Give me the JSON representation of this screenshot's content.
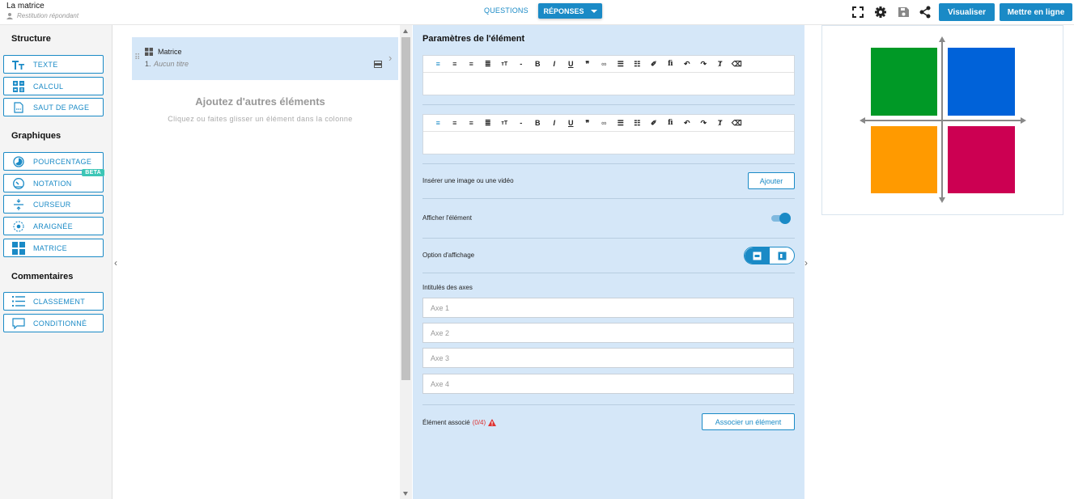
{
  "header": {
    "title": "La matrice",
    "subtitle": "Restitution répondant",
    "tabs": [
      {
        "label": "QUESTIONS"
      },
      {
        "label": "RÉPONSES"
      }
    ],
    "icons": [
      "fullscreen-icon",
      "gear-icon",
      "save-icon",
      "share-icon"
    ],
    "preview_label": "Visualiser",
    "publish_label": "Mettre en ligne"
  },
  "palette": {
    "sections": [
      {
        "title": "Structure",
        "items": [
          {
            "label": "TEXTE",
            "icon": "text-size-icon"
          },
          {
            "label": "CALCUL",
            "icon": "calculator-icon"
          },
          {
            "label": "SAUT DE PAGE",
            "icon": "page-break-icon"
          }
        ]
      },
      {
        "title": "Graphiques",
        "items": [
          {
            "label": "POURCENTAGE",
            "icon": "percentage-icon"
          },
          {
            "label": "NOTATION",
            "icon": "gauge-icon",
            "badge": "BETA"
          },
          {
            "label": "CURSEUR",
            "icon": "slider-icon"
          },
          {
            "label": "ARAIGNÉE",
            "icon": "spider-icon"
          },
          {
            "label": "MATRICE",
            "icon": "matrix-icon"
          }
        ]
      },
      {
        "title": "Commentaires",
        "items": [
          {
            "label": "CLASSEMENT",
            "icon": "list-icon"
          },
          {
            "label": "CONDITIONNÉ",
            "icon": "comment-icon"
          }
        ]
      }
    ]
  },
  "column": {
    "item": {
      "type": "Matrice",
      "number": "1.",
      "title": "Aucun titre"
    },
    "empty_title": "Ajoutez d'autres éléments",
    "empty_hint": "Cliquez ou faites glisser un élément dans la colonne"
  },
  "params": {
    "title": "Paramètres de l'élément",
    "toolbar": [
      "align-left",
      "align-center",
      "align-right",
      "justify",
      "font-size",
      "minus",
      "bold",
      "italic",
      "underline",
      "quote",
      "link",
      "bullet-list",
      "numbered-list",
      "brush",
      "font",
      "undo",
      "redo",
      "clear-format",
      "eraser"
    ],
    "insert_media_label": "Insérer une image ou une vidéo",
    "add_label": "Ajouter",
    "show_element_label": "Afficher l'élément",
    "show_element_on": true,
    "display_option_label": "Option d'affichage",
    "axes_label": "Intitulés des axes",
    "axes_placeholders": [
      "Axe 1",
      "Axe 2",
      "Axe 3",
      "Axe 4"
    ],
    "associated_label": "Élément associé",
    "associated_count": "(0/4)",
    "associate_button": "Associer un élément"
  },
  "preview": {
    "quadrant_colors": [
      "#009926",
      "#0062d9",
      "#ff9a00",
      "#cc0052"
    ]
  },
  "colors": {
    "accent": "#1a8ac6",
    "panel": "#d5e7f8"
  }
}
